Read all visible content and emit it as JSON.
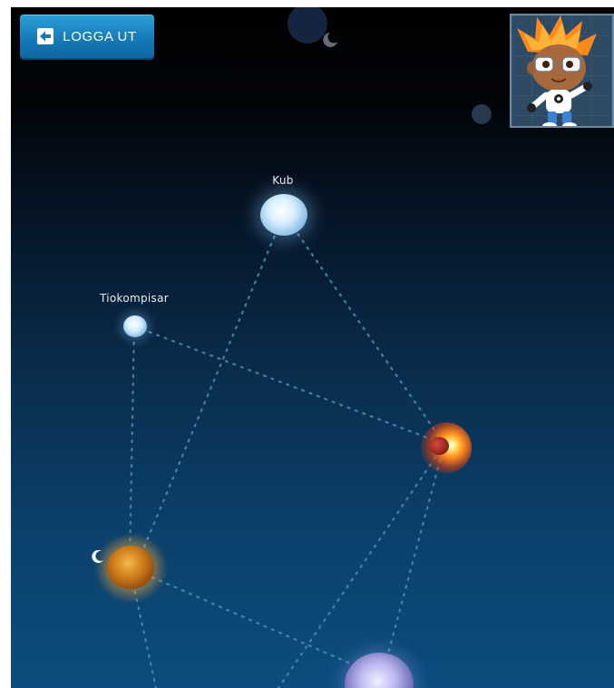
{
  "header": {
    "logout_label": "LOGGA UT"
  },
  "map": {
    "nodes": [
      {
        "id": "kub",
        "label": "Kub",
        "style": "ice",
        "colors": [
          "#e8f6ff",
          "#9cc9ea"
        ]
      },
      {
        "id": "tiokompisar",
        "label": "Tiokompisar",
        "style": "ice",
        "colors": [
          "#e8f6ff",
          "#8fbfe4"
        ]
      },
      {
        "id": "sun-planet",
        "label": "",
        "style": "fire",
        "colors": [
          "#ffd35a",
          "#c8361d"
        ]
      },
      {
        "id": "amber-planet",
        "label": "",
        "style": "amber",
        "colors": [
          "#f7b33a",
          "#8a4b10"
        ]
      },
      {
        "id": "violet-planet",
        "label": "",
        "style": "violet",
        "colors": [
          "#d6d2ff",
          "#6f6fb8"
        ]
      }
    ],
    "path_color": "#4f8fb3"
  },
  "avatar": {
    "hair_color": "#ff8a1c",
    "panel_color": "#2e4b66"
  }
}
